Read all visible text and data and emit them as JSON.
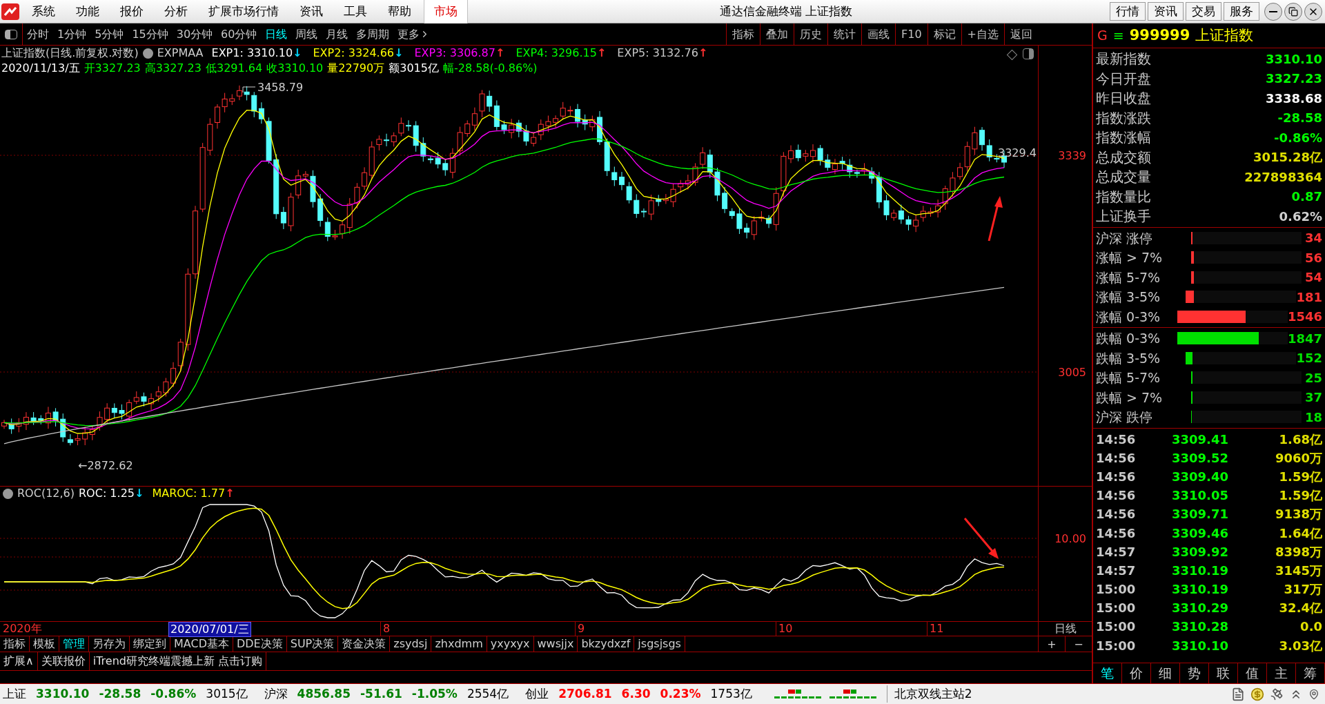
{
  "menu": {
    "items": [
      "系统",
      "功能",
      "报价",
      "分析",
      "扩展市场行情",
      "资讯",
      "工具",
      "帮助"
    ],
    "market_tab": "市场"
  },
  "window": {
    "title": "通达信金融终端 上证指数",
    "buttons": [
      "行情",
      "资讯",
      "交易",
      "服务"
    ]
  },
  "period_tabs": [
    {
      "label": "分时",
      "selected": false
    },
    {
      "label": "1分钟",
      "selected": false
    },
    {
      "label": "5分钟",
      "selected": false
    },
    {
      "label": "15分钟",
      "selected": false
    },
    {
      "label": "30分钟",
      "selected": false
    },
    {
      "label": "60分钟",
      "selected": false
    },
    {
      "label": "日线",
      "selected": true
    },
    {
      "label": "周线",
      "selected": false
    },
    {
      "label": "月线",
      "selected": false
    },
    {
      "label": "多周期",
      "selected": false
    },
    {
      "label": "更多",
      "selected": false
    }
  ],
  "chart_tools": [
    "指标",
    "叠加",
    "历史",
    "统计",
    "画线",
    "F10",
    "标记",
    "+自选",
    "返回"
  ],
  "main_chart": {
    "title": "上证指数(日线.前复权.对数)",
    "indicator": "EXPMAA",
    "exps": [
      {
        "label": "EXP1: 3310.10",
        "color": "#ffffff",
        "arrow": {
          "text": "↓",
          "color": "#00d8ff"
        }
      },
      {
        "label": "EXP2: 3324.66",
        "color": "#ffff00",
        "arrow": {
          "text": "↓",
          "color": "#00d8ff"
        }
      },
      {
        "label": "EXP3: 3306.87",
        "color": "#ff00ff",
        "arrow": {
          "text": "↑",
          "color": "#ff3030"
        }
      },
      {
        "label": "EXP4: 3296.15",
        "color": "#00ff00",
        "arrow": {
          "text": "↑",
          "color": "#ff3030"
        }
      },
      {
        "label": "EXP5: 3132.76",
        "color": "#c8c8c8",
        "arrow": {
          "text": "↑",
          "color": "#ff3030"
        }
      }
    ],
    "bar_info": [
      {
        "text": "2020/11/13/五",
        "color": "#ffffff"
      },
      {
        "text": "开3327.23",
        "color": "#00ff00"
      },
      {
        "text": "高3327.23",
        "color": "#00ff00"
      },
      {
        "text": "低3291.64",
        "color": "#00ff00"
      },
      {
        "text": "收3310.10",
        "color": "#00ff00"
      },
      {
        "text": "量22790万",
        "color": "#ffff00"
      },
      {
        "text": "额3015亿",
        "color": "#ffffff"
      },
      {
        "text": "幅-28.58(-0.86%)",
        "color": "#00ff00"
      }
    ],
    "high_label": "3458.79",
    "low_label": "←2872.62",
    "last_label": "3329.4",
    "price_axis": [
      "3339",
      "3005"
    ]
  },
  "roc_pane": {
    "title": "ROC(12,6)",
    "lines": [
      {
        "label": "ROC: 1.25",
        "color": "#ffffff",
        "arrow": {
          "text": "↓",
          "color": "#00d8ff"
        }
      },
      {
        "label": "MAROC: 1.77",
        "color": "#ffff00",
        "arrow": {
          "text": "↑",
          "color": "#ff3030"
        }
      }
    ],
    "axis": [
      "10.00"
    ]
  },
  "date_axis": {
    "year": "2020年",
    "cursor_date": "2020/07/01/三",
    "months": [
      "8",
      "9",
      "10",
      "11"
    ],
    "period": "日线"
  },
  "template_tabs": [
    {
      "label": "指标",
      "selected": false
    },
    {
      "label": "模板",
      "selected": false
    },
    {
      "label": "管理",
      "selected": true
    },
    {
      "label": "另存为",
      "selected": false
    },
    {
      "label": "绑定到",
      "selected": false
    },
    {
      "label": "MACD基本",
      "selected": false
    },
    {
      "label": "DDE决策",
      "selected": false
    },
    {
      "label": "SUP决策",
      "selected": false
    },
    {
      "label": "资金决策",
      "selected": false
    },
    {
      "label": "zsydsj",
      "selected": false
    },
    {
      "label": "zhxdmm",
      "selected": false
    },
    {
      "label": "yxyxyx",
      "selected": false
    },
    {
      "label": "wwsjjx",
      "selected": false
    },
    {
      "label": "bkzydxzf",
      "selected": false
    },
    {
      "label": "jsgsjsgs",
      "selected": false
    }
  ],
  "zoom_buttons": [
    "+",
    "−"
  ],
  "ext_row": [
    "扩展∧",
    "关联报价",
    "iTrend研究终端震撼上新 点击订购"
  ],
  "quote": {
    "flag": "G",
    "menu": "≡",
    "code": "999999",
    "name": "上证指数",
    "stats": [
      {
        "label": "最新指数",
        "value": "3310.10",
        "color": "#00ff00"
      },
      {
        "label": "今日开盘",
        "value": "3327.23",
        "color": "#00ff00"
      },
      {
        "label": "昨日收盘",
        "value": "3338.68",
        "color": "#ffffff"
      },
      {
        "label": "指数涨跌",
        "value": "-28.58",
        "color": "#00ff00"
      },
      {
        "label": "指数涨幅",
        "value": "-0.86%",
        "color": "#00ff00"
      },
      {
        "label": "总成交额",
        "value": "3015.28亿",
        "color": "#e0e000"
      },
      {
        "label": "总成交量",
        "value": "227898364",
        "color": "#e0e000"
      },
      {
        "label": "指数量比",
        "value": "0.87",
        "color": "#00ff00"
      },
      {
        "label": "上证换手",
        "value": "0.62%",
        "color": "#d0d0d0"
      }
    ]
  },
  "breadth_up": [
    {
      "label": "沪深 涨停",
      "level": 0.014,
      "value": "34"
    },
    {
      "label": "涨幅 > 7%",
      "level": 0.022,
      "value": "56"
    },
    {
      "label": "涨幅 5-7%",
      "level": 0.022,
      "value": "54"
    },
    {
      "label": "涨幅 3-5%",
      "level": 0.072,
      "value": "181"
    },
    {
      "label": "涨幅 0-3%",
      "level": 0.62,
      "value": "1546"
    }
  ],
  "breadth_down": [
    {
      "label": "跌幅 0-3%",
      "level": 0.74,
      "value": "1847"
    },
    {
      "label": "跌幅 3-5%",
      "level": 0.06,
      "value": "152"
    },
    {
      "label": "跌幅 5-7%",
      "level": 0.01,
      "value": "25"
    },
    {
      "label": "跌幅 > 7%",
      "level": 0.015,
      "value": "37"
    },
    {
      "label": "沪深 跌停",
      "level": 0.007,
      "value": "18"
    }
  ],
  "ticks": [
    {
      "time": "14:56",
      "price": "3309.41",
      "amount": "1.68亿"
    },
    {
      "time": "14:56",
      "price": "3309.52",
      "amount": "9060万"
    },
    {
      "time": "14:56",
      "price": "3309.40",
      "amount": "1.59亿"
    },
    {
      "time": "14:56",
      "price": "3310.05",
      "amount": "1.59亿"
    },
    {
      "time": "14:56",
      "price": "3309.71",
      "amount": "9138万"
    },
    {
      "time": "14:56",
      "price": "3309.46",
      "amount": "1.64亿"
    },
    {
      "time": "14:57",
      "price": "3309.92",
      "amount": "8398万"
    },
    {
      "time": "14:57",
      "price": "3310.19",
      "amount": "3145万"
    },
    {
      "time": "15:00",
      "price": "3310.19",
      "amount": "317万"
    },
    {
      "time": "15:00",
      "price": "3310.29",
      "amount": "32.4亿"
    },
    {
      "time": "15:00",
      "price": "3310.28",
      "amount": "0.0"
    },
    {
      "time": "15:00",
      "price": "3310.10",
      "amount": "3.03亿"
    }
  ],
  "detail_tabs": [
    {
      "label": "笔",
      "selected": true
    },
    {
      "label": "价",
      "selected": false
    },
    {
      "label": "细",
      "selected": false
    },
    {
      "label": "势",
      "selected": false
    },
    {
      "label": "联",
      "selected": false
    },
    {
      "label": "值",
      "selected": false
    },
    {
      "label": "主",
      "selected": false
    },
    {
      "label": "筹",
      "selected": false
    }
  ],
  "status_bar": {
    "indices": [
      {
        "name": "上证",
        "price": "3310.10",
        "change": "-28.58",
        "pct": "-0.86%",
        "amount": "3015亿",
        "color": "#008000"
      },
      {
        "name": "沪深",
        "price": "4856.85",
        "change": "-51.61",
        "pct": "-1.05%",
        "amount": "2554亿",
        "color": "#008000"
      },
      {
        "name": "创业",
        "price": "2706.81",
        "change": "6.30",
        "pct": "0.23%",
        "amount": "1753亿",
        "color": "#ff0000"
      }
    ],
    "server": "北京双线主站2"
  }
}
